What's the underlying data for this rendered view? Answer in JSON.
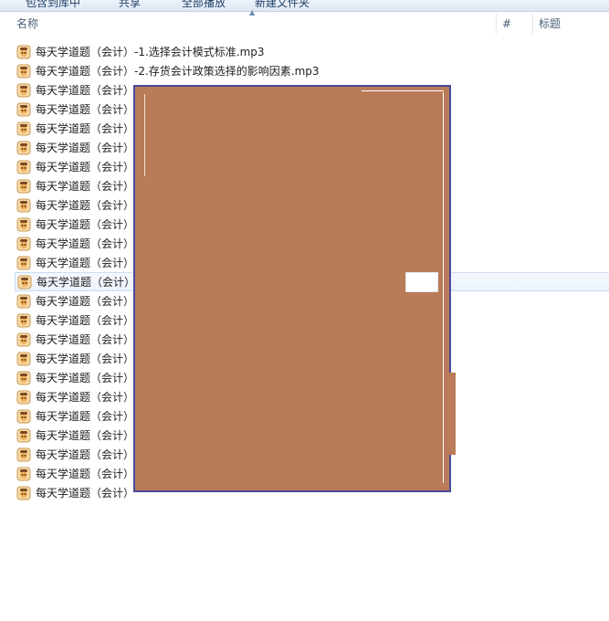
{
  "toolbar": {
    "items": [
      "包含到库中",
      "共享",
      "全部播放",
      "新建文件夹"
    ]
  },
  "columns": {
    "name": "名称",
    "number": "#",
    "title": "标题"
  },
  "files": [
    {
      "name": "每天学道题（会计）-1.选择会计模式标准.mp3"
    },
    {
      "name": "每天学道题（会计）-2.存货会计政策选择的影响因素.mp3"
    },
    {
      "name": "每天学道题（会计）"
    },
    {
      "name": "每天学道题（会计）"
    },
    {
      "name": "每天学道题（会计）"
    },
    {
      "name": "每天学道题（会计）"
    },
    {
      "name": "每天学道题（会计）"
    },
    {
      "name": "每天学道题（会计）"
    },
    {
      "name": "每天学道题（会计）"
    },
    {
      "name": "每天学道题（会计）"
    },
    {
      "name": "每天学道题（会计）"
    },
    {
      "name": "每天学道题（会计）"
    },
    {
      "name": "每天学道题（会计）",
      "selected": true
    },
    {
      "name": "每天学道题（会计）"
    },
    {
      "name": "每天学道题（会计）"
    },
    {
      "name": "每天学道题（会计）"
    },
    {
      "name": "每天学道题（会计）"
    },
    {
      "name": "每天学道题（会计）"
    },
    {
      "name": "每天学道题（会计）"
    },
    {
      "name": "每天学道题（会计）"
    },
    {
      "name": "每天学道题（会计）"
    },
    {
      "name": "每天学道题（会计）"
    },
    {
      "name": "每天学道题（会计）"
    },
    {
      "name": "每天学道题（会计）"
    }
  ],
  "icons": {
    "file": "audio-file-icon"
  },
  "colors": {
    "redaction": "#b97b58",
    "redaction_border": "#4a4aa0",
    "selection": "#ecf3fd",
    "header_text": "#4c607a"
  }
}
